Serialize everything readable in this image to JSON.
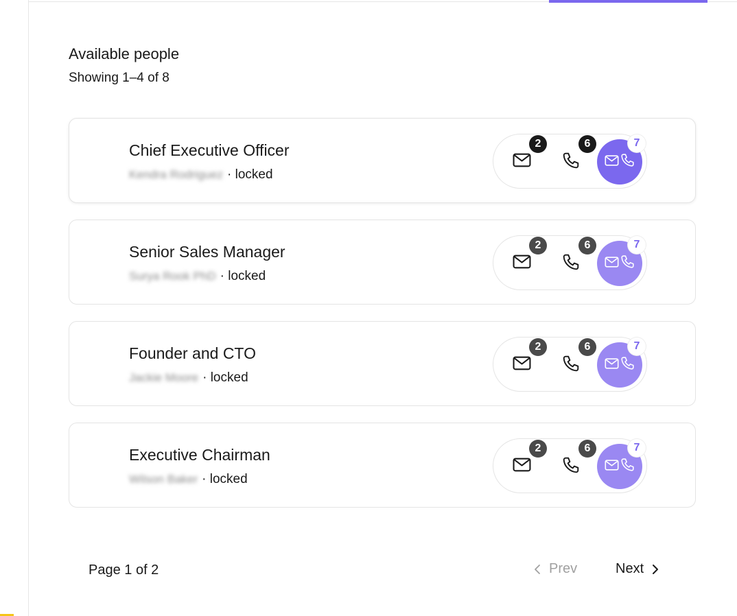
{
  "header": {
    "title": "Available people",
    "showing": "Showing 1–4 of 8"
  },
  "colors": {
    "accent": "#7b68ee",
    "both_btn_primary": "#7b68ee",
    "both_btn_secondary": "#9a88f2"
  },
  "people": [
    {
      "title": "Chief Executive Officer",
      "name": "Kendra Rodriguez",
      "status": "· locked",
      "email_count": "2",
      "phone_count": "6",
      "both_count": "7"
    },
    {
      "title": "Senior Sales Manager",
      "name": "Surya Rook PhD",
      "status": "· locked",
      "email_count": "2",
      "phone_count": "6",
      "both_count": "7"
    },
    {
      "title": "Founder and CTO",
      "name": "Jackie Moore",
      "status": "· locked",
      "email_count": "2",
      "phone_count": "6",
      "both_count": "7"
    },
    {
      "title": "Executive Chairman",
      "name": "Wilson Baker",
      "status": "· locked",
      "email_count": "2",
      "phone_count": "6",
      "both_count": "7"
    }
  ],
  "pagination": {
    "label": "Page 1 of 2",
    "prev": "Prev",
    "next": "Next",
    "prev_icon": "chevron-left-icon",
    "next_icon": "chevron-right-icon"
  },
  "icons": {
    "email": "mail-icon",
    "phone": "phone-icon"
  }
}
